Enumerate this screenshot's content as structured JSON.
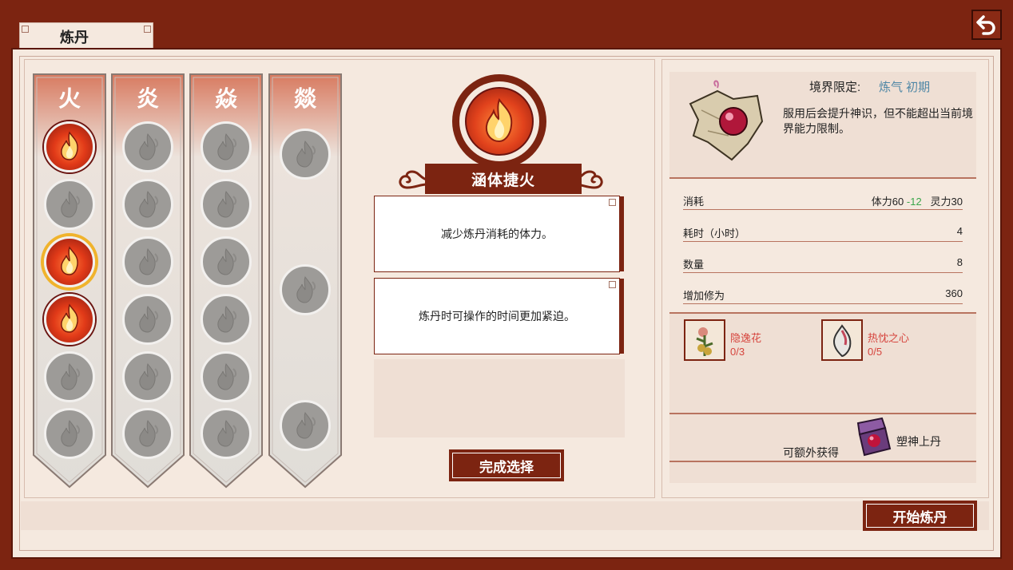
{
  "tab": {
    "label": "炼丹"
  },
  "banners": [
    {
      "title": "火",
      "orbs": [
        "on",
        "off",
        "sel",
        "on",
        "off",
        "off"
      ]
    },
    {
      "title": "炎",
      "orbs": [
        "off",
        "off",
        "off",
        "off",
        "off",
        "off"
      ]
    },
    {
      "title": "焱",
      "orbs": [
        "off",
        "off",
        "off",
        "off",
        "off",
        "off"
      ]
    },
    {
      "title": "燚",
      "orbs": [
        "off",
        "off",
        "off"
      ]
    }
  ],
  "selected": {
    "name": "涵体捷火",
    "effects": [
      "减少炼丹消耗的体力。",
      "炼丹时可操作的时间更加紧迫。"
    ]
  },
  "confirm_button": "完成选择",
  "start_button": "开始炼丹",
  "detail": {
    "realm_label": "境界限定:",
    "realm_value": "炼气 初期",
    "description": "服用后会提升神识，但不能超出当前境界能力限制。",
    "stats": [
      {
        "key": "消耗",
        "value": ""
      },
      {
        "key": "耗时（小时）",
        "value": "4"
      },
      {
        "key": "数量",
        "value": "8"
      },
      {
        "key": "增加修为",
        "value": "360"
      }
    ],
    "cost": {
      "stamina": "体力60",
      "stamina_delta": "-12",
      "spirit": "灵力30"
    },
    "materials": [
      {
        "name": "隐逸花",
        "count": "0/3"
      },
      {
        "name": "热忱之心",
        "count": "0/5"
      }
    ],
    "extra_label": "可额外获得",
    "extra_item": "塑神上丹"
  },
  "colors": {
    "accent": "#7c2411",
    "fire": "#e13a18",
    "highlight": "#f0b32c",
    "realm": "#4f87a6",
    "delta": "#3aa64a"
  }
}
